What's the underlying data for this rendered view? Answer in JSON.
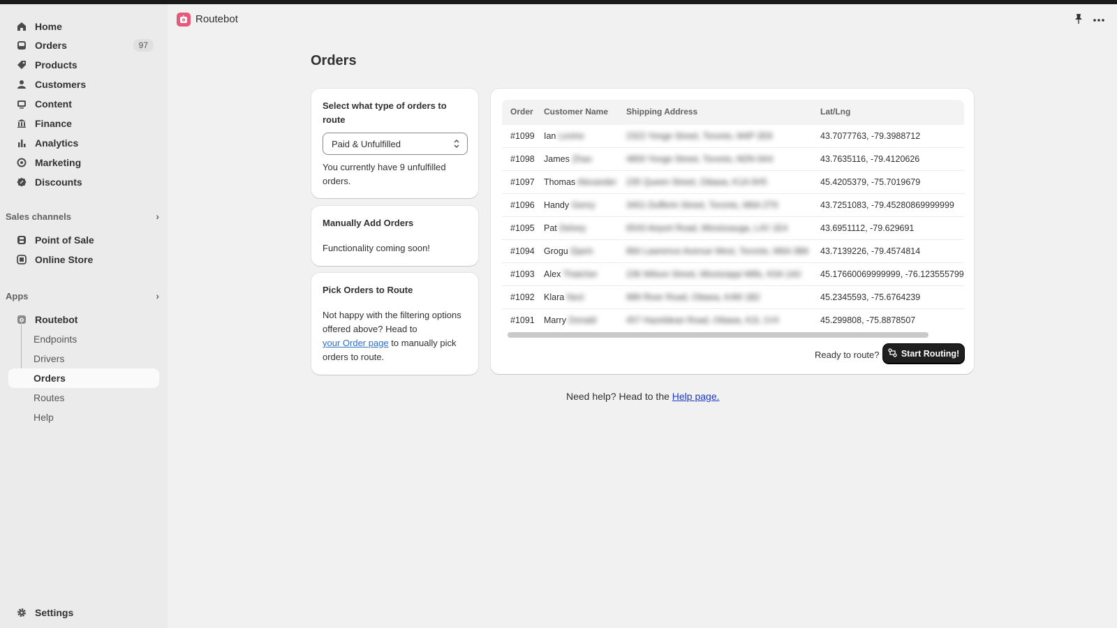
{
  "sidebar": {
    "items": [
      {
        "label": "Home",
        "icon": "home-icon"
      },
      {
        "label": "Orders",
        "icon": "inbox-icon",
        "count": "97"
      },
      {
        "label": "Products",
        "icon": "tag-icon"
      },
      {
        "label": "Customers",
        "icon": "person-icon"
      },
      {
        "label": "Content",
        "icon": "content-icon"
      },
      {
        "label": "Finance",
        "icon": "bank-icon"
      },
      {
        "label": "Analytics",
        "icon": "bar-chart-icon"
      },
      {
        "label": "Marketing",
        "icon": "target-icon"
      },
      {
        "label": "Discounts",
        "icon": "discount-icon"
      }
    ],
    "sales_channels": {
      "heading": "Sales channels",
      "items": [
        {
          "label": "Point of Sale",
          "icon": "pos-icon"
        },
        {
          "label": "Online Store",
          "icon": "store-icon"
        }
      ]
    },
    "apps": {
      "heading": "Apps",
      "app": {
        "label": "Routebot",
        "icon": "routebot-icon"
      },
      "subitems": [
        {
          "label": "Endpoints"
        },
        {
          "label": "Drivers"
        },
        {
          "label": "Orders",
          "active": true
        },
        {
          "label": "Routes"
        },
        {
          "label": "Help"
        }
      ]
    },
    "settings": {
      "label": "Settings",
      "icon": "gear-icon"
    }
  },
  "header": {
    "title": "Routebot",
    "accent": "#e45a7a"
  },
  "page": {
    "title": "Orders"
  },
  "filter_card": {
    "title": "Select what type of orders to route",
    "select_value": "Paid & Unfulfilled",
    "note": "You currently have 9 unfulfilled orders."
  },
  "manual_card": {
    "title": "Manually Add Orders",
    "text": "Functionality coming soon!"
  },
  "pick_card": {
    "title": "Pick Orders to Route",
    "text_before": "Not happy with the filtering options offered above? Head to",
    "link": "your Order page",
    "text_after": "to manually pick orders to route."
  },
  "table": {
    "headers": [
      "Order",
      "Customer Name",
      "Shipping Address",
      "Lat/Lng"
    ],
    "rows": [
      {
        "order": "#1099",
        "first": "Ian",
        "last": "Levine",
        "address": "2322 Yonge Street, Toronto, M4P 2E8",
        "latlng": "43.7077763, -79.3988712"
      },
      {
        "order": "#1098",
        "first": "James",
        "last": "Zhao",
        "address": "4800 Yonge Street, Toronto, M2N 6A4",
        "latlng": "43.7635116, -79.4120626"
      },
      {
        "order": "#1097",
        "first": "Thomas",
        "last": "Alexander",
        "address": "235 Queen Street, Ottawa, K1A 0H5",
        "latlng": "45.4205379, -75.7019679"
      },
      {
        "order": "#1096",
        "first": "Handy",
        "last": "Genry",
        "address": "3401 Dufferin Street, Toronto, M6A 2T9",
        "latlng": "43.7251083, -79.45280869999999"
      },
      {
        "order": "#1095",
        "first": "Pat",
        "last": "Delvey",
        "address": "6543 Airport Road, Mississauga, L4V 1E4",
        "latlng": "43.6951112, -79.629691"
      },
      {
        "order": "#1094",
        "first": "Grogu",
        "last": "Djarin",
        "address": "860 Lawrence Avenue West, Toronto, M6A 3B6",
        "latlng": "43.7139226, -79.4574814"
      },
      {
        "order": "#1093",
        "first": "Alex",
        "last": "Thatcher",
        "address": "236 Wilson Street, Mississippi Mills, K0A 1A0",
        "latlng": "45.17660069999999, -76.123555799"
      },
      {
        "order": "#1092",
        "first": "Klara",
        "last": "Nezi",
        "address": "989 River Road, Ottawa, K4M 1B2",
        "latlng": "45.2345593, -75.6764239"
      },
      {
        "order": "#1091",
        "first": "Marry",
        "last": "Donald",
        "address": "457 Hazeldean Road, Ottawa, K2L 1V4",
        "latlng": "45.299808, -75.8878507"
      }
    ],
    "ready_text": "Ready to route?",
    "start_button": "Start Routing!"
  },
  "help": {
    "text": "Need help? Head to the",
    "link": "Help page."
  }
}
